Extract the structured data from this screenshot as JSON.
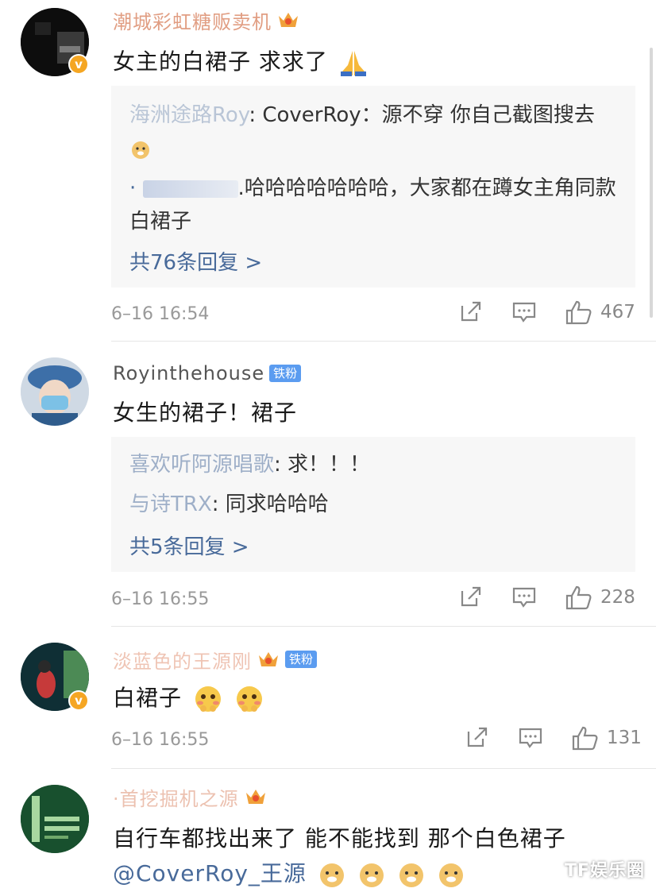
{
  "comments": [
    {
      "username": "潮城彩虹糖贩卖机",
      "vip_crown": true,
      "verified": true,
      "text": "女主的白裙子  求求了",
      "text_emoji": "pray-emoji",
      "replies": [
        {
          "name": "海洲途路Roy",
          "sep": ": ",
          "text": "CoverRoy：源不穿 你自己截图搜去",
          "emoji": "doge-emoji"
        },
        {
          "name": "·",
          "sep": "",
          "text": ".哈哈哈哈哈哈哈，大家都在蹲女主角同款白裙子",
          "emoji": ""
        }
      ],
      "more": "共76条回复 >",
      "time": "6–16 16:54",
      "likes": "467"
    },
    {
      "username": "Royinthehouse",
      "badge": "铁粉",
      "text": "女生的裙子！裙子",
      "replies": [
        {
          "name": "喜欢听阿源唱歌",
          "sep": ": ",
          "text": "求！！！"
        },
        {
          "name": "与诗TRX",
          "sep": ": ",
          "text": "同求哈哈哈"
        }
      ],
      "more": "共5条回复 >",
      "time": "6–16 16:55",
      "likes": "228"
    },
    {
      "username": "淡蓝色的王源刚",
      "vip_crown": true,
      "badge": "铁粉",
      "verified": true,
      "text": "白裙子",
      "time": "6–16 16:55",
      "likes": "131"
    },
    {
      "username": "·首挖掘机之源",
      "vip_crown": true,
      "text": "自行车都找出来了  能不能找到 那个白色裙子",
      "mention": "@CoverRoy_王源",
      "time": "",
      "likes": ""
    }
  ],
  "watermark": "TF娱乐圈",
  "colors": {
    "link": "#486a9a",
    "reply_bg": "#f7f7f7",
    "meta": "#999999",
    "badge": "#5b9cf0",
    "vip": "#f5a623"
  }
}
